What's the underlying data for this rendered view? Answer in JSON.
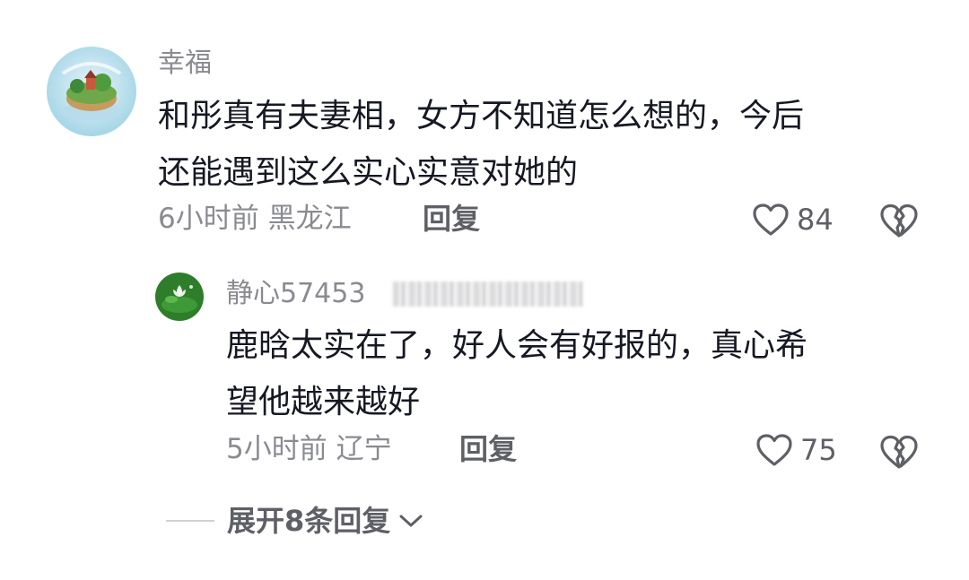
{
  "comment": {
    "username": "幸福",
    "text": "和彤真有夫妻相，女方不知道怎么想的，今后\n还能遇到这么实心实意对她的",
    "time_location": "6小时前 黑龙江",
    "reply_label": "回复",
    "like_count": "84",
    "avatar_icon": "island-avatar",
    "reply": {
      "username": "静心57453",
      "text": "鹿晗太实在了，好人会有好报的，真心希\n望他越来越好",
      "time_location": "5小时前 辽宁",
      "reply_label": "回复",
      "like_count": "75",
      "avatar_icon": "lotus-avatar"
    },
    "expand_label": "展开8条回复"
  },
  "colors": {
    "text_primary": "#161823",
    "text_secondary": "#8a8b91",
    "action_gray": "#5f6066"
  },
  "icons": {
    "like": "heart-outline-icon",
    "dislike": "broken-heart-icon",
    "expand": "chevron-down-icon"
  }
}
